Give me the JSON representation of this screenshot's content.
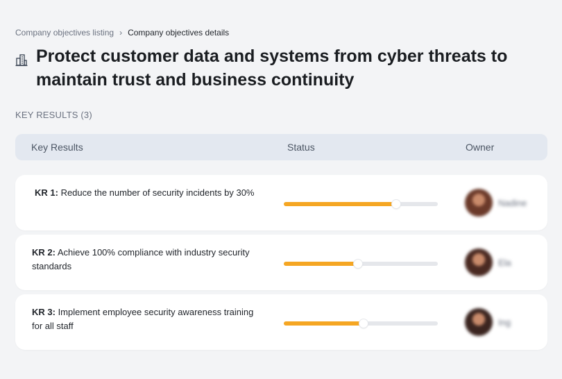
{
  "breadcrumb": {
    "parent": "Company objectives listing",
    "separator": "›",
    "current": "Company objectives details"
  },
  "objective": {
    "icon": "building-icon",
    "title": "Protect customer data and systems from cyber threats to maintain trust and business continuity"
  },
  "key_results_count_label": "KEY RESULTS (3)",
  "table": {
    "headers": {
      "key_results": "Key Results",
      "status": "Status",
      "owner": "Owner"
    },
    "rows": [
      {
        "id_label": "KR 1:",
        "text": " Reduce the number of security incidents by 30%",
        "progress": 0.73,
        "owner_name": "Nadine",
        "avatar_color": "#6b3a2a"
      },
      {
        "id_label": "KR 2:",
        "text": " Achieve 100% compliance with industry security standards",
        "progress": 0.48,
        "owner_name": "Ela",
        "avatar_color": "#4a2a22"
      },
      {
        "id_label": "KR 3:",
        "text": " Implement employee security awareness training for all staff",
        "progress": 0.52,
        "owner_name": "Ing",
        "avatar_color": "#3b2520"
      }
    ]
  },
  "colors": {
    "progress_fill": "#f5a623",
    "progress_track": "#e5e7eb",
    "header_bg": "#e3e8f0",
    "page_bg": "#f3f4f6"
  }
}
